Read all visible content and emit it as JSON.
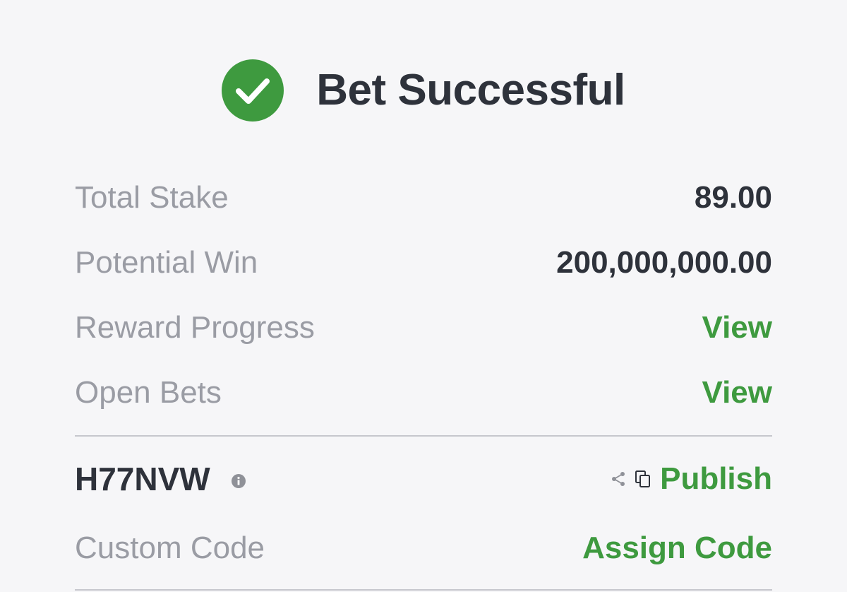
{
  "header": {
    "title": "Bet Successful",
    "status_icon": "check-circle-icon",
    "accent_color": "#3e9a3f"
  },
  "summary": {
    "total_stake": {
      "label": "Total Stake",
      "value": "89.00"
    },
    "potential_win": {
      "label": "Potential Win",
      "value": "200,000,000.00"
    },
    "reward_progress": {
      "label": "Reward Progress",
      "action": "View"
    },
    "open_bets": {
      "label": "Open Bets",
      "action": "View"
    }
  },
  "booking": {
    "code": "H77NVW",
    "info_icon": "info-icon",
    "share_icon": "share-icon",
    "copy_icon": "copy-icon",
    "publish_label": "Publish"
  },
  "custom_code": {
    "label": "Custom Code",
    "action": "Assign Code"
  }
}
